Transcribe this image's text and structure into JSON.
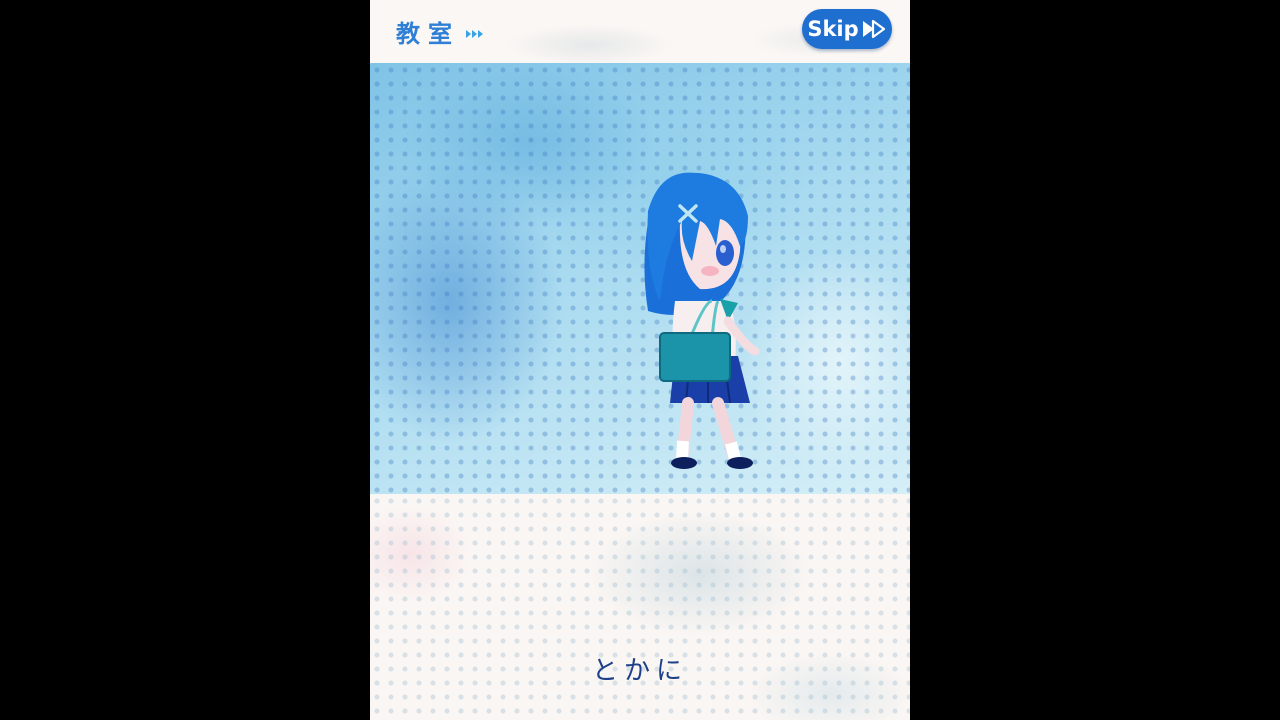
{
  "header": {
    "location": "教室"
  },
  "skip_button": {
    "label": "Skip",
    "icon": "fast-forward-icon"
  },
  "dialogue": {
    "text": "とかに"
  },
  "colors": {
    "accent": "#2f7fd6",
    "skip_bg": "#1f6fd0",
    "dialogue": "#1e3f8a",
    "letterbox": "#000000"
  }
}
